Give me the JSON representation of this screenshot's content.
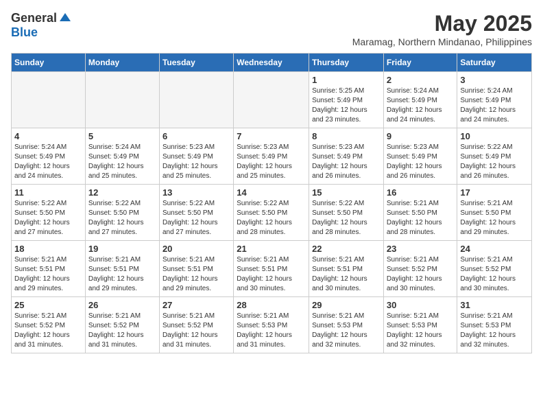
{
  "logo": {
    "general": "General",
    "blue": "Blue"
  },
  "title": "May 2025",
  "location": "Maramag, Northern Mindanao, Philippines",
  "days_of_week": [
    "Sunday",
    "Monday",
    "Tuesday",
    "Wednesday",
    "Thursday",
    "Friday",
    "Saturday"
  ],
  "weeks": [
    [
      {
        "day": "",
        "info": ""
      },
      {
        "day": "",
        "info": ""
      },
      {
        "day": "",
        "info": ""
      },
      {
        "day": "",
        "info": ""
      },
      {
        "day": "1",
        "info": "Sunrise: 5:25 AM\nSunset: 5:49 PM\nDaylight: 12 hours\nand 23 minutes."
      },
      {
        "day": "2",
        "info": "Sunrise: 5:24 AM\nSunset: 5:49 PM\nDaylight: 12 hours\nand 24 minutes."
      },
      {
        "day": "3",
        "info": "Sunrise: 5:24 AM\nSunset: 5:49 PM\nDaylight: 12 hours\nand 24 minutes."
      }
    ],
    [
      {
        "day": "4",
        "info": "Sunrise: 5:24 AM\nSunset: 5:49 PM\nDaylight: 12 hours\nand 24 minutes."
      },
      {
        "day": "5",
        "info": "Sunrise: 5:24 AM\nSunset: 5:49 PM\nDaylight: 12 hours\nand 25 minutes."
      },
      {
        "day": "6",
        "info": "Sunrise: 5:23 AM\nSunset: 5:49 PM\nDaylight: 12 hours\nand 25 minutes."
      },
      {
        "day": "7",
        "info": "Sunrise: 5:23 AM\nSunset: 5:49 PM\nDaylight: 12 hours\nand 25 minutes."
      },
      {
        "day": "8",
        "info": "Sunrise: 5:23 AM\nSunset: 5:49 PM\nDaylight: 12 hours\nand 26 minutes."
      },
      {
        "day": "9",
        "info": "Sunrise: 5:23 AM\nSunset: 5:49 PM\nDaylight: 12 hours\nand 26 minutes."
      },
      {
        "day": "10",
        "info": "Sunrise: 5:22 AM\nSunset: 5:49 PM\nDaylight: 12 hours\nand 26 minutes."
      }
    ],
    [
      {
        "day": "11",
        "info": "Sunrise: 5:22 AM\nSunset: 5:50 PM\nDaylight: 12 hours\nand 27 minutes."
      },
      {
        "day": "12",
        "info": "Sunrise: 5:22 AM\nSunset: 5:50 PM\nDaylight: 12 hours\nand 27 minutes."
      },
      {
        "day": "13",
        "info": "Sunrise: 5:22 AM\nSunset: 5:50 PM\nDaylight: 12 hours\nand 27 minutes."
      },
      {
        "day": "14",
        "info": "Sunrise: 5:22 AM\nSunset: 5:50 PM\nDaylight: 12 hours\nand 28 minutes."
      },
      {
        "day": "15",
        "info": "Sunrise: 5:22 AM\nSunset: 5:50 PM\nDaylight: 12 hours\nand 28 minutes."
      },
      {
        "day": "16",
        "info": "Sunrise: 5:21 AM\nSunset: 5:50 PM\nDaylight: 12 hours\nand 28 minutes."
      },
      {
        "day": "17",
        "info": "Sunrise: 5:21 AM\nSunset: 5:50 PM\nDaylight: 12 hours\nand 29 minutes."
      }
    ],
    [
      {
        "day": "18",
        "info": "Sunrise: 5:21 AM\nSunset: 5:51 PM\nDaylight: 12 hours\nand 29 minutes."
      },
      {
        "day": "19",
        "info": "Sunrise: 5:21 AM\nSunset: 5:51 PM\nDaylight: 12 hours\nand 29 minutes."
      },
      {
        "day": "20",
        "info": "Sunrise: 5:21 AM\nSunset: 5:51 PM\nDaylight: 12 hours\nand 29 minutes."
      },
      {
        "day": "21",
        "info": "Sunrise: 5:21 AM\nSunset: 5:51 PM\nDaylight: 12 hours\nand 30 minutes."
      },
      {
        "day": "22",
        "info": "Sunrise: 5:21 AM\nSunset: 5:51 PM\nDaylight: 12 hours\nand 30 minutes."
      },
      {
        "day": "23",
        "info": "Sunrise: 5:21 AM\nSunset: 5:52 PM\nDaylight: 12 hours\nand 30 minutes."
      },
      {
        "day": "24",
        "info": "Sunrise: 5:21 AM\nSunset: 5:52 PM\nDaylight: 12 hours\nand 30 minutes."
      }
    ],
    [
      {
        "day": "25",
        "info": "Sunrise: 5:21 AM\nSunset: 5:52 PM\nDaylight: 12 hours\nand 31 minutes."
      },
      {
        "day": "26",
        "info": "Sunrise: 5:21 AM\nSunset: 5:52 PM\nDaylight: 12 hours\nand 31 minutes."
      },
      {
        "day": "27",
        "info": "Sunrise: 5:21 AM\nSunset: 5:52 PM\nDaylight: 12 hours\nand 31 minutes."
      },
      {
        "day": "28",
        "info": "Sunrise: 5:21 AM\nSunset: 5:53 PM\nDaylight: 12 hours\nand 31 minutes."
      },
      {
        "day": "29",
        "info": "Sunrise: 5:21 AM\nSunset: 5:53 PM\nDaylight: 12 hours\nand 32 minutes."
      },
      {
        "day": "30",
        "info": "Sunrise: 5:21 AM\nSunset: 5:53 PM\nDaylight: 12 hours\nand 32 minutes."
      },
      {
        "day": "31",
        "info": "Sunrise: 5:21 AM\nSunset: 5:53 PM\nDaylight: 12 hours\nand 32 minutes."
      }
    ]
  ]
}
